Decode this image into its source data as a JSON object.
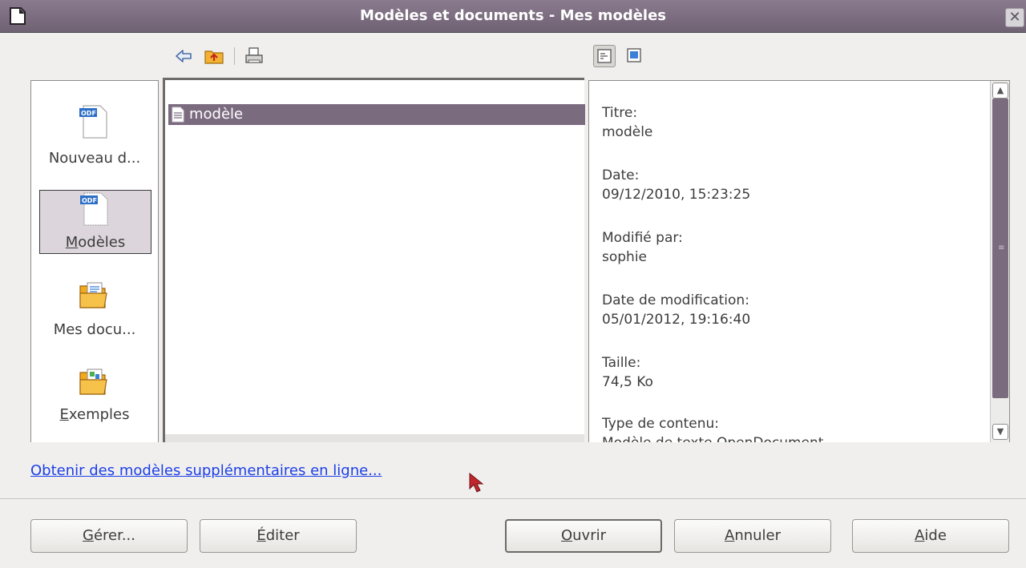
{
  "window": {
    "title": "Modèles et documents - Mes modèles",
    "close_glyph": "✕"
  },
  "toolbar": {
    "icons": [
      "back-arrow-icon",
      "folder-up-icon",
      "print-icon"
    ],
    "view_icons": [
      "document-properties-icon",
      "document-preview-icon"
    ],
    "active_view": "document-properties-icon"
  },
  "categories": [
    {
      "label": "Nouveau d...",
      "icon": "odf-document-icon",
      "selected": false
    },
    {
      "label_mnemonic": "M",
      "label_rest": "odèles",
      "icon": "odf-template-icon",
      "selected": true
    },
    {
      "label": "Mes docu...",
      "icon": "my-documents-folder-icon",
      "selected": false
    },
    {
      "label_mnemonic": "E",
      "label_rest": "xemples",
      "icon": "examples-folder-icon",
      "selected": false
    }
  ],
  "files": [
    {
      "name": "modèle",
      "icon": "text-document-icon",
      "selected": true
    }
  ],
  "properties": [
    {
      "label": "Titre:",
      "value": "modèle"
    },
    {
      "label": "Date:",
      "value": "09/12/2010, 15:23:25"
    },
    {
      "label": "Modifié par:",
      "value": "sophie"
    },
    {
      "label": "Date de modification:",
      "value": "05/01/2012, 19:16:40"
    },
    {
      "label": "Taille:",
      "value": "74,5 Ko"
    },
    {
      "label": "Type de contenu:",
      "value": "Modèle de texte OpenDocument"
    }
  ],
  "link": {
    "text": "Obtenir des modèles supplémentaires en ligne..."
  },
  "buttons": {
    "manage": {
      "mnemonic": "G",
      "rest": "érer..."
    },
    "edit": {
      "mnemonic": "É",
      "rest": "diter"
    },
    "open": {
      "mnemonic": "O",
      "rest": "uvrir"
    },
    "cancel": {
      "mnemonic": "A",
      "rest": "nnuler"
    },
    "help": {
      "mnemonic": "A",
      "rest": "ide"
    }
  },
  "colors": {
    "titlebar": "#7b6b7f",
    "selection": "#7b6b7f",
    "link": "#1c3fe8",
    "cursor": "#c0272d"
  }
}
